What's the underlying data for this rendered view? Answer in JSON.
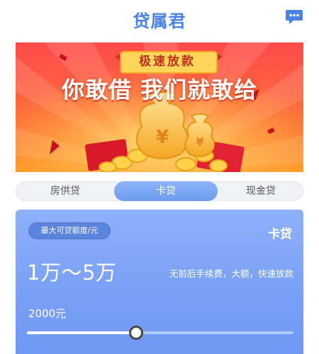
{
  "header": {
    "title": "贷属君",
    "chat_icon": "chat-bubble-icon",
    "accent_color": "#4a82e6"
  },
  "banner": {
    "tag": "极速放款",
    "slogan": "你敢借 我们就敢给",
    "coin_symbol": "¥"
  },
  "tabs": [
    {
      "label": "房供贷",
      "active": false
    },
    {
      "label": "卡贷",
      "active": true
    },
    {
      "label": "现金贷",
      "active": false
    }
  ],
  "card": {
    "limit_label": "最大可贷额度/元",
    "type": "卡贷",
    "range": "1万～5万",
    "description": "无前后手续费，大额，快速放款",
    "amount": "2000元",
    "slider_fraction": 0.41
  }
}
